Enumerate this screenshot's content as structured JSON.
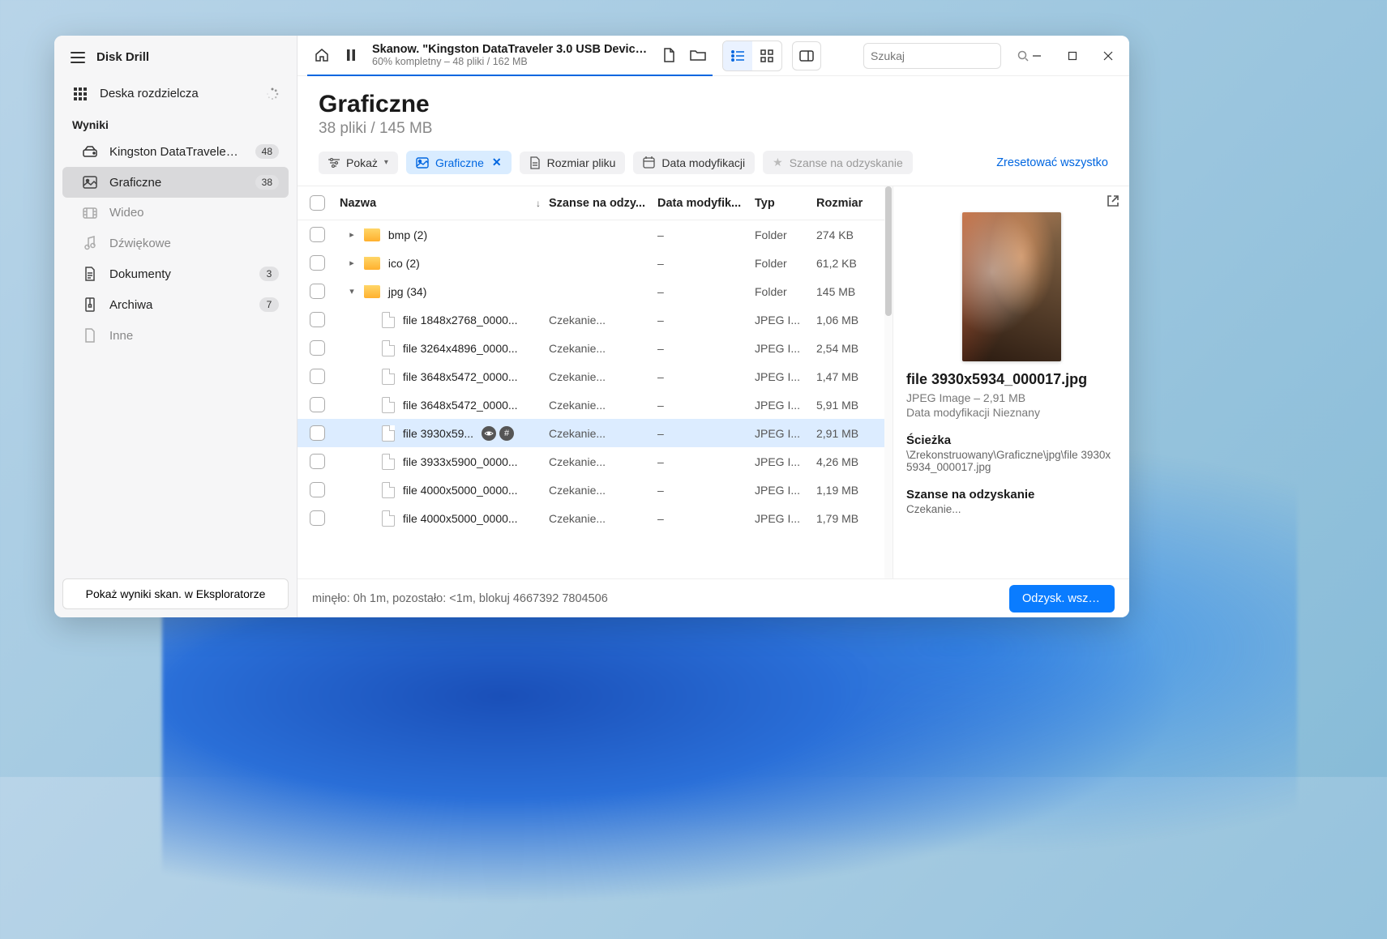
{
  "app": {
    "title": "Disk Drill"
  },
  "sidebar": {
    "dashboard": "Deska rozdzielcza",
    "results_label": "Wyniki",
    "device": "Kingston DataTraveler 3.0...",
    "device_badge": "48",
    "items": [
      {
        "label": "Graficzne",
        "badge": "38",
        "active": true,
        "dim": false
      },
      {
        "label": "Wideo",
        "badge": "",
        "active": false,
        "dim": true
      },
      {
        "label": "Dźwiękowe",
        "badge": "",
        "active": false,
        "dim": true
      },
      {
        "label": "Dokumenty",
        "badge": "3",
        "active": false,
        "dim": false
      },
      {
        "label": "Archiwa",
        "badge": "7",
        "active": false,
        "dim": false
      },
      {
        "label": "Inne",
        "badge": "",
        "active": false,
        "dim": true
      }
    ],
    "bottom_button": "Pokaż wyniki skan. w Eksploratorze"
  },
  "titlebar": {
    "title": "Skanow. \"Kingston DataTraveler 3.0 USB Device.d...",
    "subtitle": "60% kompletny – 48 pliki / 162 MB",
    "search_placeholder": "Szukaj"
  },
  "content": {
    "heading": "Graficzne",
    "subheading": "38 pliki / 145 MB"
  },
  "filters": {
    "show": "Pokaż",
    "graphics": "Graficzne",
    "filesize": "Rozmiar pliku",
    "moddate": "Data modyfikacji",
    "chances": "Szanse na odzyskanie",
    "reset": "Zresetować wszystko"
  },
  "columns": {
    "name": "Nazwa",
    "chance": "Szanse na odzy...",
    "date": "Data modyfik...",
    "type": "Typ",
    "size": "Rozmiar"
  },
  "rows": [
    {
      "depth": 0,
      "kind": "folder",
      "expand": "right",
      "name": "bmp (2)",
      "chance": "",
      "date": "–",
      "type": "Folder",
      "size": "274 KB"
    },
    {
      "depth": 0,
      "kind": "folder",
      "expand": "right",
      "name": "ico (2)",
      "chance": "",
      "date": "–",
      "type": "Folder",
      "size": "61,2 KB"
    },
    {
      "depth": 0,
      "kind": "folder",
      "expand": "down",
      "name": "jpg (34)",
      "chance": "",
      "date": "–",
      "type": "Folder",
      "size": "145 MB"
    },
    {
      "depth": 1,
      "kind": "file",
      "name": "file 1848x2768_0000...",
      "chance": "Czekanie...",
      "date": "–",
      "type": "JPEG I...",
      "size": "1,06 MB"
    },
    {
      "depth": 1,
      "kind": "file",
      "name": "file 3264x4896_0000...",
      "chance": "Czekanie...",
      "date": "–",
      "type": "JPEG I...",
      "size": "2,54 MB"
    },
    {
      "depth": 1,
      "kind": "file",
      "name": "file 3648x5472_0000...",
      "chance": "Czekanie...",
      "date": "–",
      "type": "JPEG I...",
      "size": "1,47 MB"
    },
    {
      "depth": 1,
      "kind": "file",
      "name": "file 3648x5472_0000...",
      "chance": "Czekanie...",
      "date": "–",
      "type": "JPEG I...",
      "size": "5,91 MB"
    },
    {
      "depth": 1,
      "kind": "file",
      "name": "file 3930x59...",
      "chance": "Czekanie...",
      "date": "–",
      "type": "JPEG I...",
      "size": "2,91 MB",
      "selected": true,
      "badges": true
    },
    {
      "depth": 1,
      "kind": "file",
      "name": "file 3933x5900_0000...",
      "chance": "Czekanie...",
      "date": "–",
      "type": "JPEG I...",
      "size": "4,26 MB"
    },
    {
      "depth": 1,
      "kind": "file",
      "name": "file 4000x5000_0000...",
      "chance": "Czekanie...",
      "date": "–",
      "type": "JPEG I...",
      "size": "1,19 MB"
    },
    {
      "depth": 1,
      "kind": "file",
      "name": "file 4000x5000_0000...",
      "chance": "Czekanie...",
      "date": "–",
      "type": "JPEG I...",
      "size": "1,79 MB"
    }
  ],
  "preview": {
    "filename": "file 3930x5934_000017.jpg",
    "meta1": "JPEG Image – 2,91 MB",
    "meta2": "Data modyfikacji Nieznany",
    "path_label": "Ścieżka",
    "path_value": "\\Zrekonstruowany\\Graficzne\\jpg\\file 3930x5934_000017.jpg",
    "chance_label": "Szanse na odzyskanie",
    "chance_value": "Czekanie..."
  },
  "footer": {
    "status": "minęło: 0h 1m, pozostało: <1m, blokuj 4667392 7804506",
    "recover": "Odzysk. wszyst..."
  }
}
